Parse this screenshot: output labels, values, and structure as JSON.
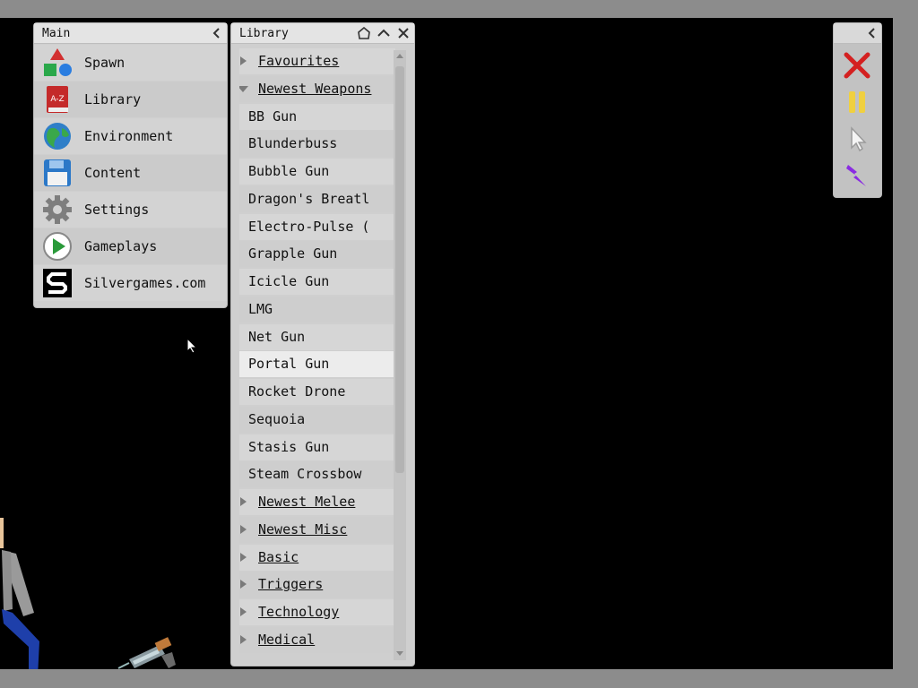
{
  "main_panel": {
    "title": "Main",
    "items": [
      {
        "label": "Spawn",
        "icon": "spawn-shapes-icon"
      },
      {
        "label": "Library",
        "icon": "library-book-icon"
      },
      {
        "label": "Environment",
        "icon": "globe-icon"
      },
      {
        "label": "Content",
        "icon": "floppy-disk-icon"
      },
      {
        "label": "Settings",
        "icon": "gear-icon"
      },
      {
        "label": "Gameplays",
        "icon": "play-icon"
      },
      {
        "label": "Silvergames.com",
        "icon": "silvergames-logo-icon"
      }
    ]
  },
  "library_panel": {
    "title": "Library",
    "rows": [
      {
        "type": "category",
        "label": "Favourites",
        "expanded": false
      },
      {
        "type": "category",
        "label": "Newest Weapons",
        "expanded": true
      },
      {
        "type": "item",
        "label": "BB Gun"
      },
      {
        "type": "item",
        "label": "Blunderbuss"
      },
      {
        "type": "item",
        "label": "Bubble Gun"
      },
      {
        "type": "item",
        "label": "Dragon's Breatl"
      },
      {
        "type": "item",
        "label": "Electro-Pulse ("
      },
      {
        "type": "item",
        "label": "Grapple Gun"
      },
      {
        "type": "item",
        "label": "Icicle Gun"
      },
      {
        "type": "item",
        "label": "LMG"
      },
      {
        "type": "item",
        "label": "Net Gun"
      },
      {
        "type": "item",
        "label": "Portal Gun",
        "selected": true
      },
      {
        "type": "item",
        "label": "Rocket Drone"
      },
      {
        "type": "item",
        "label": "Sequoia"
      },
      {
        "type": "item",
        "label": "Stasis Gun"
      },
      {
        "type": "item",
        "label": "Steam Crossbow"
      },
      {
        "type": "category",
        "label": "Newest Melee",
        "expanded": false
      },
      {
        "type": "category",
        "label": "Newest Misc",
        "expanded": false
      },
      {
        "type": "category",
        "label": "Basic",
        "expanded": false
      },
      {
        "type": "category",
        "label": "Triggers",
        "expanded": false
      },
      {
        "type": "category",
        "label": "Technology",
        "expanded": false
      },
      {
        "type": "category",
        "label": "Medical",
        "expanded": false
      }
    ]
  },
  "toolbar": {
    "tools": [
      {
        "name": "delete-tool-icon",
        "color": "#d42020"
      },
      {
        "name": "pause-icon",
        "color": "#f0d040"
      },
      {
        "name": "pointer-tool-icon",
        "color": "#f2f2f2"
      },
      {
        "name": "lightning-tool-icon",
        "color": "#8a2be2"
      }
    ]
  },
  "colors": {
    "viewport": "#000000",
    "frame": "#8c8c8c",
    "panel": "#cfcfcf",
    "selected_row": "#ececec"
  }
}
